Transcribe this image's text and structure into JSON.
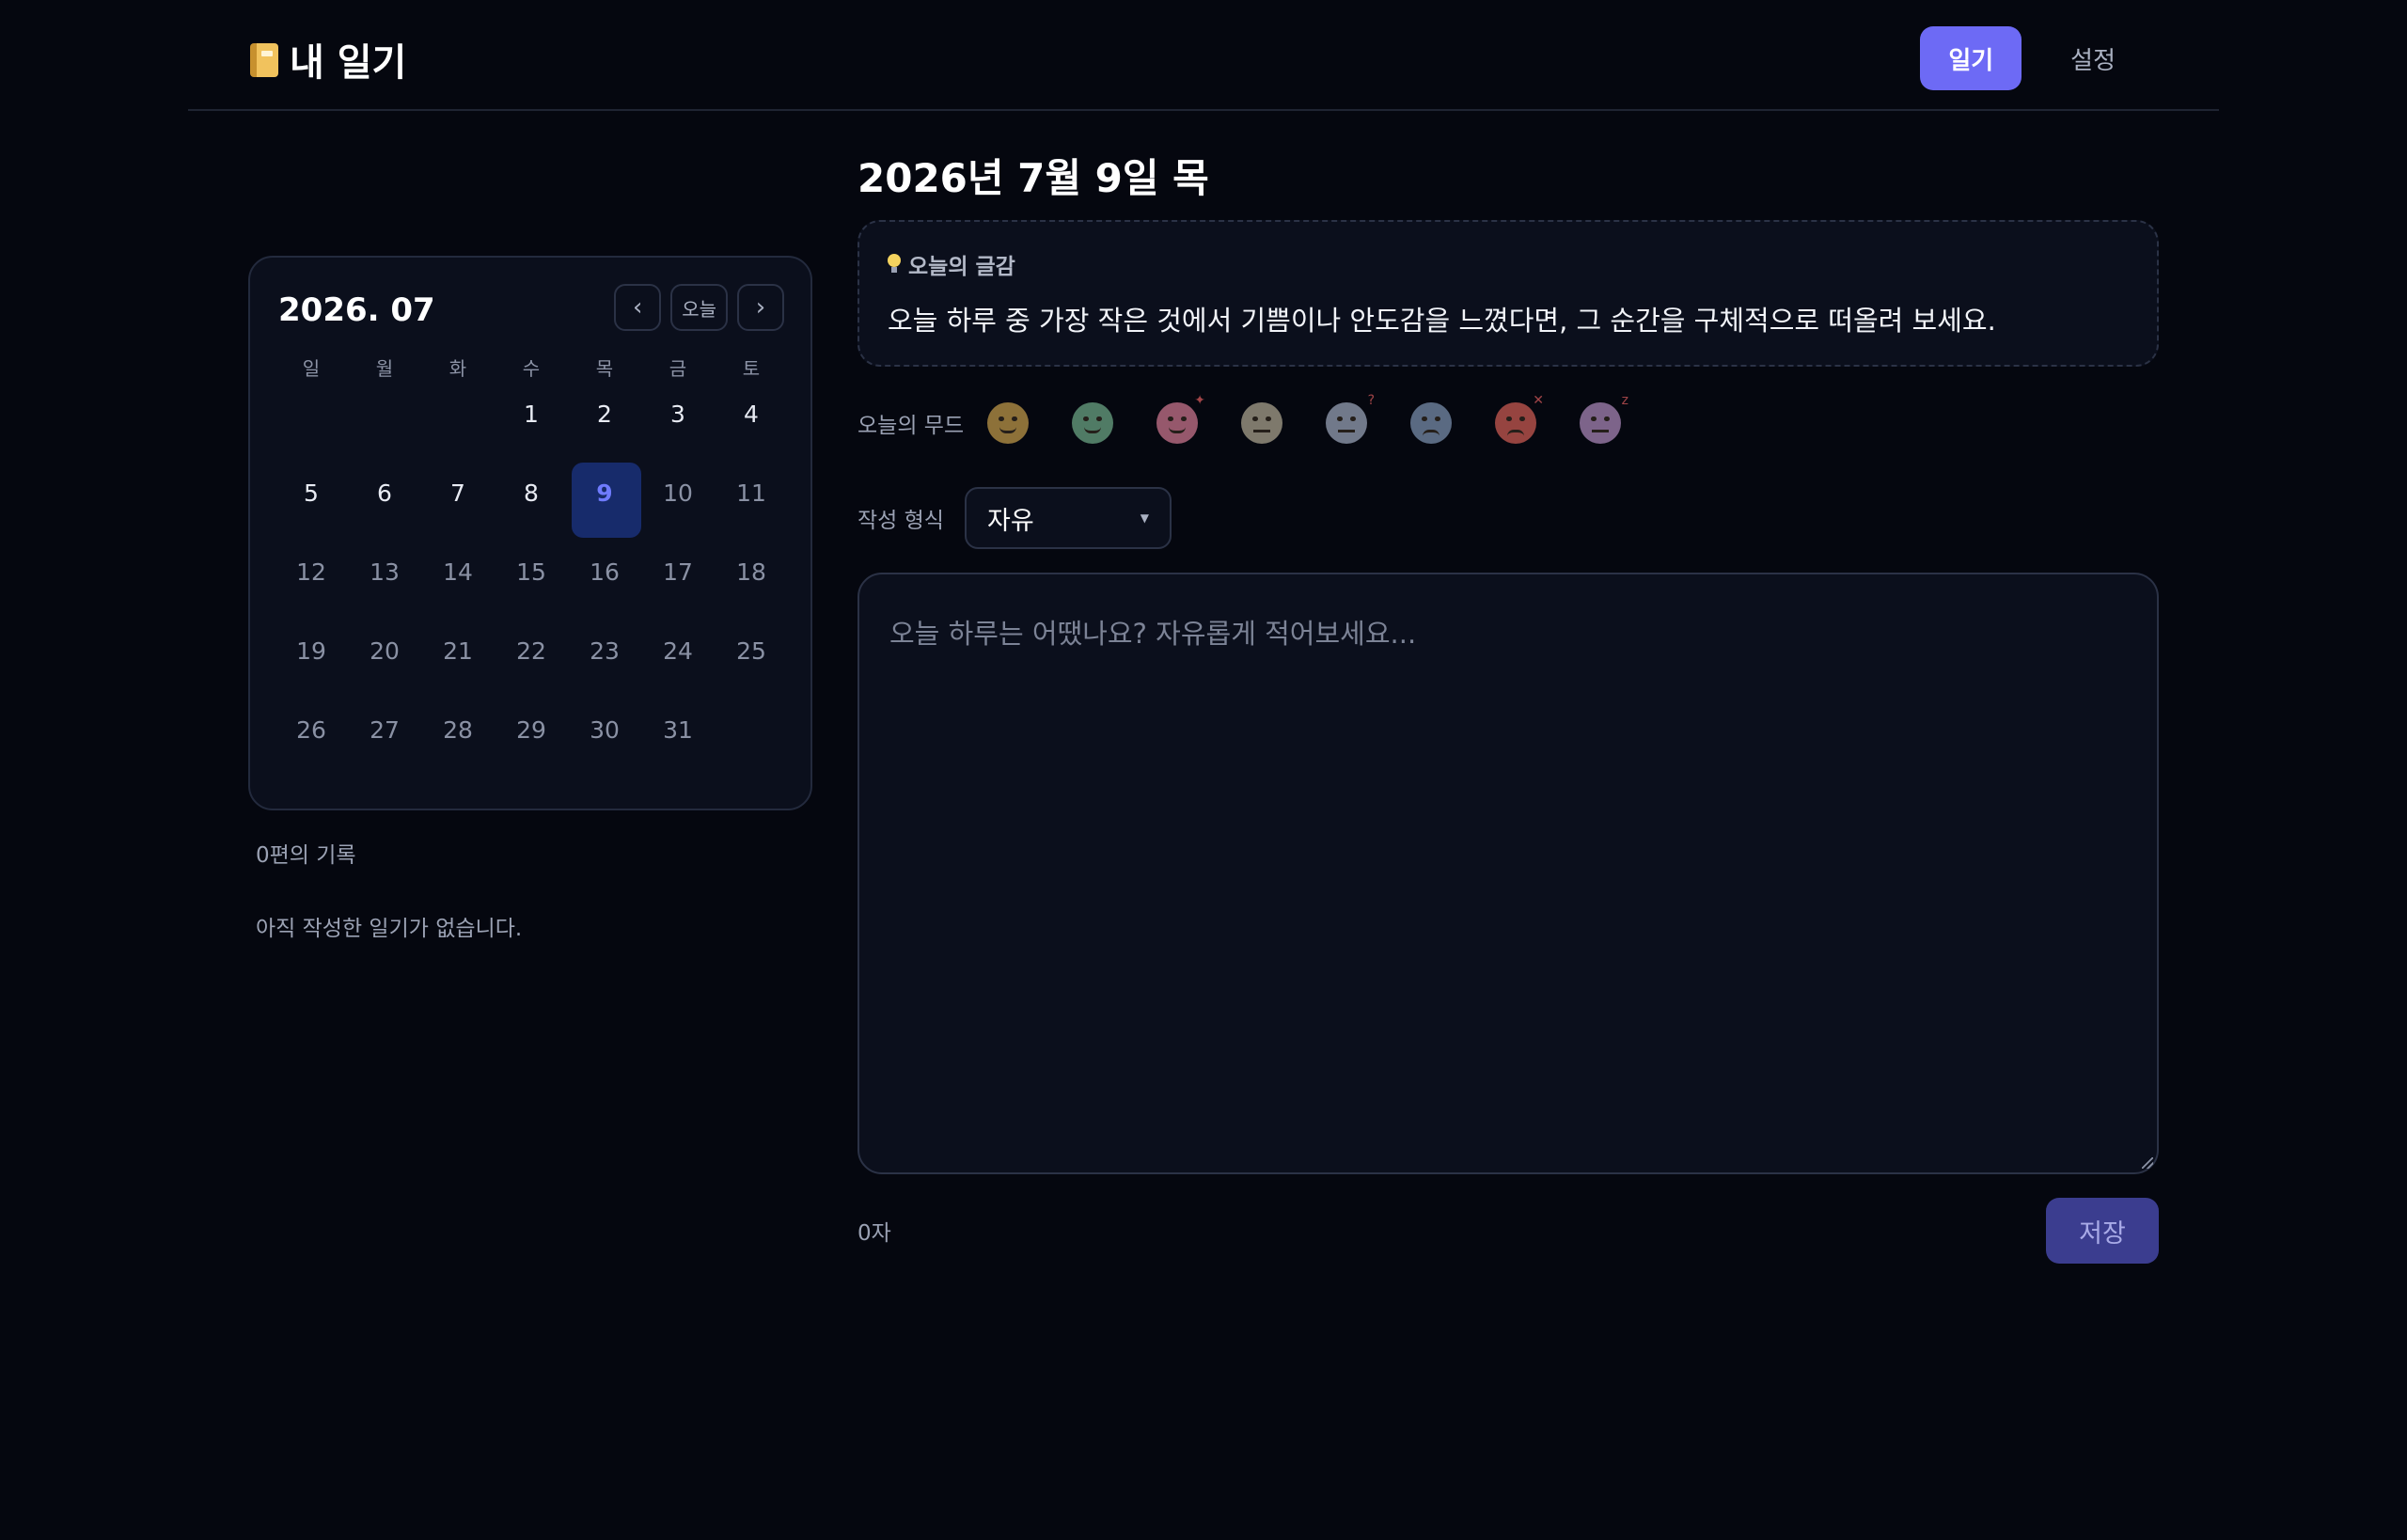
{
  "header": {
    "brand_icon": "notebook-icon",
    "brand_title": "내 일기",
    "nav": [
      {
        "label": "일기",
        "active": true
      },
      {
        "label": "설정",
        "active": false
      }
    ],
    "accent_color": "#6d6af5"
  },
  "calendar": {
    "title": "2026. 07",
    "prev_label": "‹",
    "today_label": "오늘",
    "next_label": "›",
    "weekdays": [
      "일",
      "월",
      "화",
      "수",
      "목",
      "금",
      "토"
    ],
    "leading_blanks": 3,
    "days": [
      "1",
      "2",
      "3",
      "4",
      "5",
      "6",
      "7",
      "8",
      "9",
      "10",
      "11",
      "12",
      "13",
      "14",
      "15",
      "16",
      "17",
      "18",
      "19",
      "20",
      "21",
      "22",
      "23",
      "24",
      "25",
      "26",
      "27",
      "28",
      "29",
      "30",
      "31"
    ],
    "selected_day": "9",
    "last_highlighted_day": 9
  },
  "sidebar": {
    "record_count": "0편의 기록",
    "empty_message": "아직 작성한 일기가 없습니다."
  },
  "entry": {
    "date_title": "2026년 7월 9일 목",
    "prompt_label": "오늘의 글감",
    "prompt_text": "오늘 하루 중 가장 작은 것에서 기쁨이나 안도감을 느꼈다면, 그 순간을 구체적으로 떠올려 보세요.",
    "mood_label": "오늘의 무드",
    "moods": [
      {
        "name": "happy-mood-icon",
        "color": "#e0b354"
      },
      {
        "name": "calm-mood-icon",
        "color": "#7fc39a"
      },
      {
        "name": "excited-mood-icon",
        "color": "#f08aa6"
      },
      {
        "name": "neutral-mood-icon",
        "color": "#c8c0a6"
      },
      {
        "name": "confused-mood-icon",
        "color": "#b4bfd6"
      },
      {
        "name": "sad-mood-icon",
        "color": "#8fa7c9"
      },
      {
        "name": "angry-mood-icon",
        "color": "#ef6a5e"
      },
      {
        "name": "tired-mood-icon",
        "color": "#c79ed6"
      }
    ],
    "format_label": "작성 형식",
    "format_value": "자유",
    "editor_placeholder": "오늘 하루는 어땠나요? 자유롭게 적어보세요...",
    "char_count": "0자",
    "save_label": "저장"
  }
}
